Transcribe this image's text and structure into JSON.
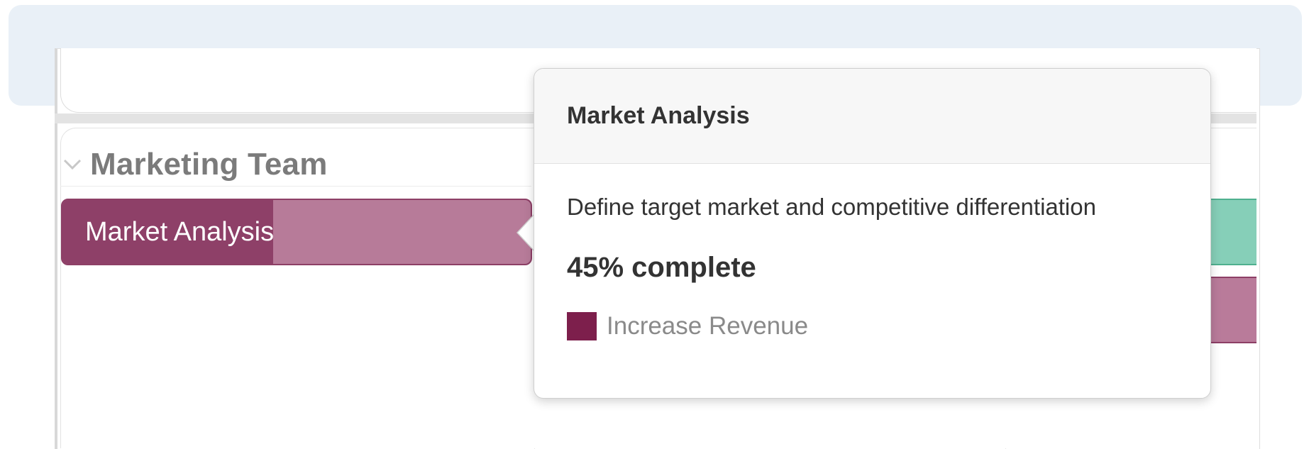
{
  "group": {
    "title": "Marketing Team"
  },
  "task": {
    "label": "Market Analysis",
    "progress_percent": 45,
    "colors": {
      "bar": "#b77b99",
      "progress": "#8e4068",
      "border": "#8d3f66"
    }
  },
  "tooltip": {
    "title": "Market Analysis",
    "description": "Define target market and competitive differentiation",
    "progress_text": "45% complete",
    "goal": {
      "label": "Increase Revenue",
      "color": "#7d1f4c"
    }
  },
  "neighbors": {
    "green_bar_color": "#86cfb8",
    "pink_bar_color": "#b97b9a"
  }
}
